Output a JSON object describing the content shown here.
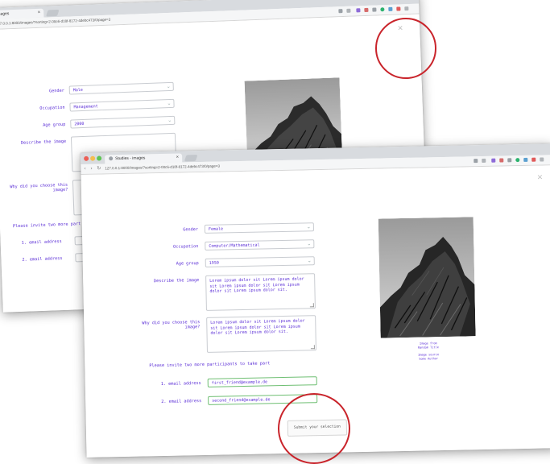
{
  "back_window": {
    "tab_title": "images",
    "tab_close": "×",
    "url": "127.0.0.1:8000/images/?sorting=2-00c6-d18f-8172-4debc473/0/page=3",
    "form": {
      "gender_label": "Gender",
      "gender_value": "Male",
      "occupation_label": "Occupation",
      "occupation_value": "Management",
      "age_label": "Age group",
      "age_value": "2000",
      "describe_label": "Describe the image",
      "why_label": "Why did you choose this image?",
      "invite_text": "Please invite two more part",
      "email1_label": "1. email address",
      "email2_label": "2. email address"
    },
    "close_x": "×"
  },
  "front_window": {
    "tab_title": "Studies - images",
    "tab_close": "×",
    "url": "127.0.0.1:8000/images/?sorting=2-00c6-d18f-8172-4debc473/0/page=3",
    "form": {
      "gender_label": "Gender",
      "gender_value": "Female",
      "occupation_label": "Occupation",
      "occupation_value": "Computer/Mathematical",
      "age_label": "Age group",
      "age_value": "1950",
      "describe_label": "Describe the image",
      "describe_value": "Lorem ipsum dolor sit Lorem ipsum dolor sit Lorem ipsum dolor sit Lorem ipsum dolor sit Lorem ipsum dolor sit.",
      "why_label": "Why did you choose this image?",
      "why_value": "Lorem ipsum dolor sit Lorem ipsum dolor sit Lorem ipsum dolor sit Lorem ipsum dolor sit Lorem ipsum dolor sit.",
      "invite_text": "Please invite two more participants to take part",
      "email1_label": "1. email address",
      "email1_value": "first_friend@example.de",
      "email2_label": "2. email address",
      "email2_value": "second_friend@example.de",
      "submit_label": "Submit your selection"
    },
    "caption": {
      "line1": "Image from",
      "line2": "Random Title",
      "line3": "Image source",
      "line4": "Some Author"
    },
    "close_x": "×"
  },
  "annotations": {
    "circle_color": "#c9242b"
  },
  "colors": {
    "accent_text": "#5a2dd6",
    "email_border": "#6fbf73"
  }
}
